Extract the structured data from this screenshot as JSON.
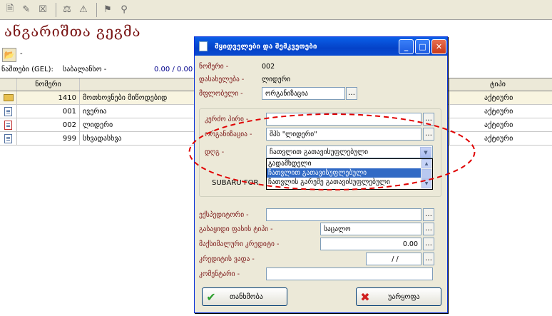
{
  "toolbar": {
    "icons": [
      "new-document-icon",
      "edit-document-icon",
      "delete-document-icon",
      "filter-icon",
      "clear-filter-icon",
      "bookmark-icon",
      "find-icon"
    ]
  },
  "app": {
    "title": "ანგარიშთა გეგმა",
    "folder_dash": "-"
  },
  "balance": {
    "label": "ნაშთები (GEL):",
    "subtitle": "საბალანსო -",
    "value": "0.00 / 0.00"
  },
  "grid": {
    "headers": {
      "number": "ნომერი",
      "type": "ტიპი"
    },
    "rows": [
      {
        "icon": "folder-icon",
        "number": "1410",
        "name": "მოთხოვნები მიწოდებიდ",
        "type": "აქტიური"
      },
      {
        "icon": "document-icon",
        "number": "001",
        "name": "ივერია",
        "type": "აქტიური"
      },
      {
        "icon": "document-red-icon",
        "number": "002",
        "name": "ლიდერი",
        "type": "აქტიური"
      },
      {
        "icon": "document-icon",
        "number": "999",
        "name": "სხვადასხვა",
        "type": "აქტიური"
      }
    ]
  },
  "dialog": {
    "title": "მყიდველები და შემკვეთები",
    "number_label": "ნომერი -",
    "number_value": "002",
    "name_label": "დასახელება -",
    "name_value": "ლიდერი",
    "owner_label": "მფლობელი -",
    "owner_value": "ორგანიზაცია",
    "card_label": "კერძო პირი -",
    "card_value": "",
    "org_label": "ორგანიზაცია -",
    "org_value": "შპს \"ლიდერი\"",
    "vat_label": "დღგ -",
    "vat_value": "ჩათვლით გათავისუფლებული",
    "vat_options": [
      "გადამხდელი",
      "ჩათვლით გათავისუფლებული",
      "ჩათვლის გარეშე გათავისუფლებული"
    ],
    "vat_selected_index": 1,
    "behind_text": "SUBARU FOR",
    "expeditor_label": "ექსპედიტორი -",
    "expeditor_value": "",
    "price_type_label": "გასაყიდი ფასის ტიპი -",
    "price_type_value": "საცალო",
    "max_credit_label": "მაქსიმალური კრედიტი -",
    "max_credit_value": "0.00",
    "credit_term_label": "კრედიტის ვადა -",
    "credit_term_value": "/   /",
    "comment_label": "კომენტარი -",
    "comment_value": "",
    "ok_label": "თანხმობა",
    "cancel_label": "უარყოფა"
  },
  "colors": {
    "title_maroon": "#7a1414",
    "dialog_title_blue": "#0542c8",
    "annotation_red": "#e00000",
    "ok_green": "#2a9d2a",
    "cancel_red": "#d02020"
  }
}
